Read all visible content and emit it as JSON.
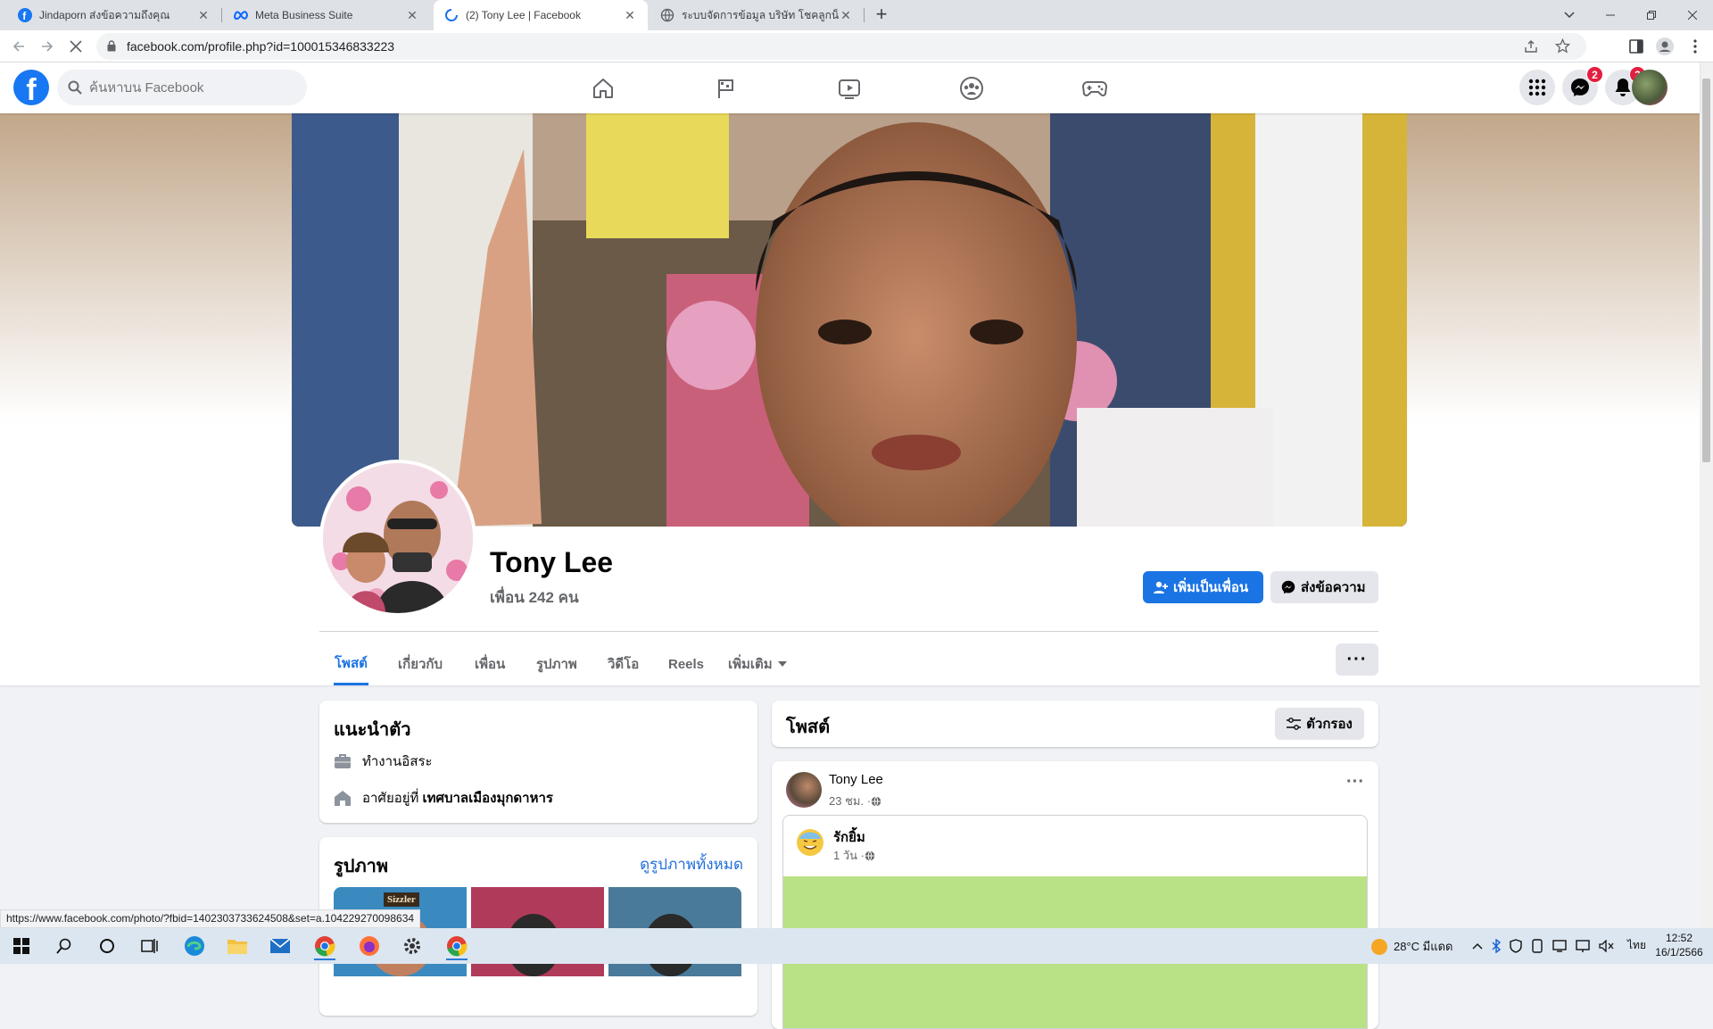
{
  "browser": {
    "tabs": [
      {
        "title": "Jindaporn ส่งข้อความถึงคุณ",
        "icon": "facebook-icon"
      },
      {
        "title": "Meta Business Suite",
        "icon": "meta-icon"
      },
      {
        "title": "(2) Tony Lee | Facebook",
        "icon": "loading-icon"
      },
      {
        "title": "ระบบจัดการข้อมูล บริษัท โชคลูกน็อต ...",
        "icon": "globe-icon"
      }
    ],
    "url": "facebook.com/profile.php?id=100015346833223",
    "status_url": "https://www.facebook.com/photo/?fbid=1402303733624508&set=a.104229270098634"
  },
  "header": {
    "logo": "f",
    "search_placeholder": "ค้นหาบน Facebook",
    "messenger_badge": "2",
    "notifications_badge": "2",
    "colors": {
      "brand": "#1877f2",
      "badge": "#e41e3f"
    }
  },
  "profile": {
    "name": "Tony Lee",
    "friends": "เพื่อน 242 คน",
    "add_friend_label": "เพิ่มเป็นเพื่อน",
    "message_label": "ส่งข้อความ",
    "tabs": [
      "โพสต์",
      "เกี่ยวกับ",
      "เพื่อน",
      "รูปภาพ",
      "วิดีโอ",
      "Reels",
      "เพิ่มเติม"
    ],
    "more_dots": "···"
  },
  "intro": {
    "title": "แนะนำตัว",
    "work": "ทำงานอิสระ",
    "lives_prefix": "อาศัยอยู่ที่ ",
    "lives_place": "เทศบาลเมืองมุกดาหาร"
  },
  "photos": {
    "title": "รูปภาพ",
    "see_all": "ดูรูปภาพทั้งหมด",
    "first_caption": "Sizzler"
  },
  "posts": {
    "title": "โพสต์",
    "filter_label": "ตัวกรอง",
    "post": {
      "author": "Tony Lee",
      "time": "23 ชม. · ",
      "shared_author": "รักยิ้ม",
      "shared_time": "1 วัน · "
    }
  },
  "taskbar": {
    "weather": "28°C  มีแดด",
    "lang": "ไทย",
    "time": "12:52",
    "date": "16/1/2566"
  }
}
